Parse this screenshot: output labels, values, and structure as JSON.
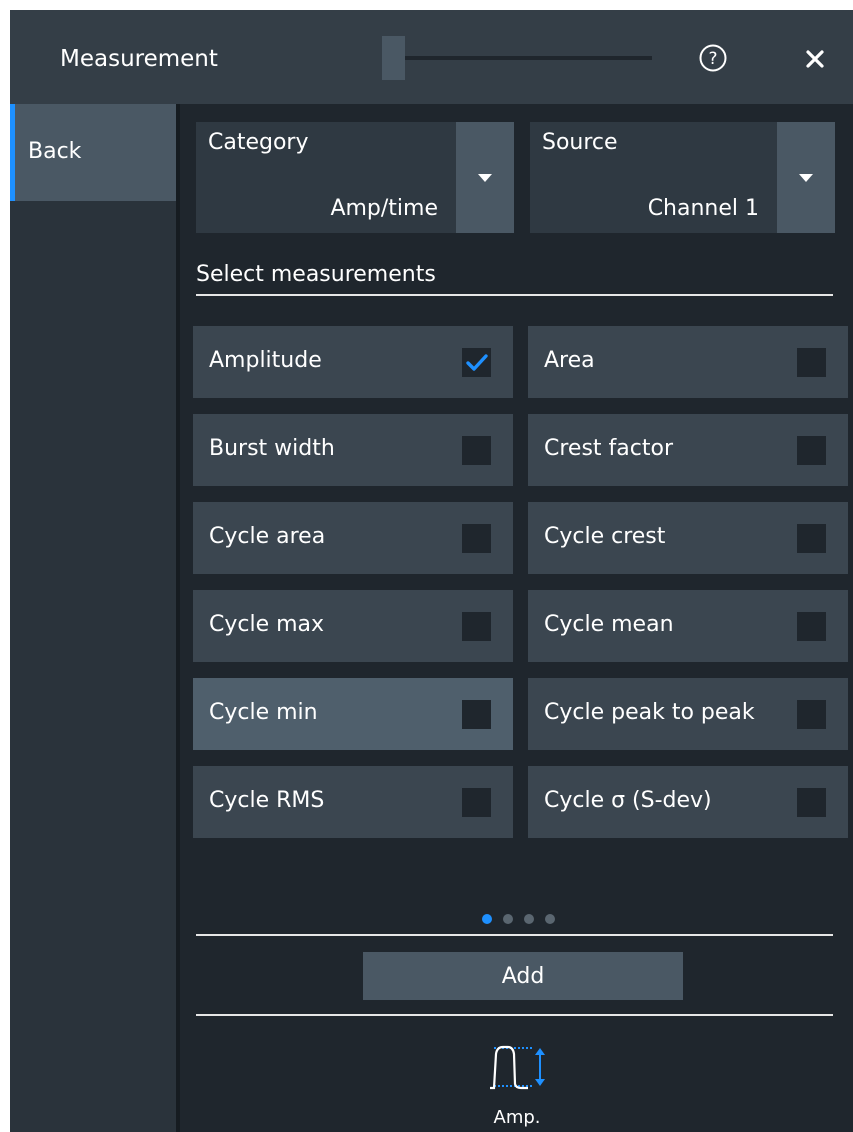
{
  "header": {
    "title": "Measurement",
    "help_icon": "help-circle-icon",
    "close_icon": "close-icon"
  },
  "nav": {
    "back_label": "Back",
    "accent_color": "#1e90ff"
  },
  "category": {
    "label": "Category",
    "value": "Amp/time"
  },
  "source": {
    "label": "Source",
    "value": "Channel 1"
  },
  "section_title": "Select measurements",
  "measurements": [
    {
      "label": "Amplitude",
      "checked": true
    },
    {
      "label": "Area",
      "checked": false
    },
    {
      "label": "Burst width",
      "checked": false
    },
    {
      "label": "Crest factor",
      "checked": false
    },
    {
      "label": "Cycle area",
      "checked": false
    },
    {
      "label": "Cycle crest",
      "checked": false
    },
    {
      "label": "Cycle max",
      "checked": false
    },
    {
      "label": "Cycle mean",
      "checked": false
    },
    {
      "label": "Cycle min",
      "checked": false,
      "highlighted": true
    },
    {
      "label": "Cycle peak to peak",
      "checked": false
    },
    {
      "label": "Cycle RMS",
      "checked": false
    },
    {
      "label": "Cycle σ (S-dev)",
      "checked": false
    }
  ],
  "pagination": {
    "pages": 4,
    "current": 1
  },
  "add_label": "Add",
  "quick_item": {
    "label": "Amp.",
    "icon": "amplitude-waveform-icon"
  }
}
